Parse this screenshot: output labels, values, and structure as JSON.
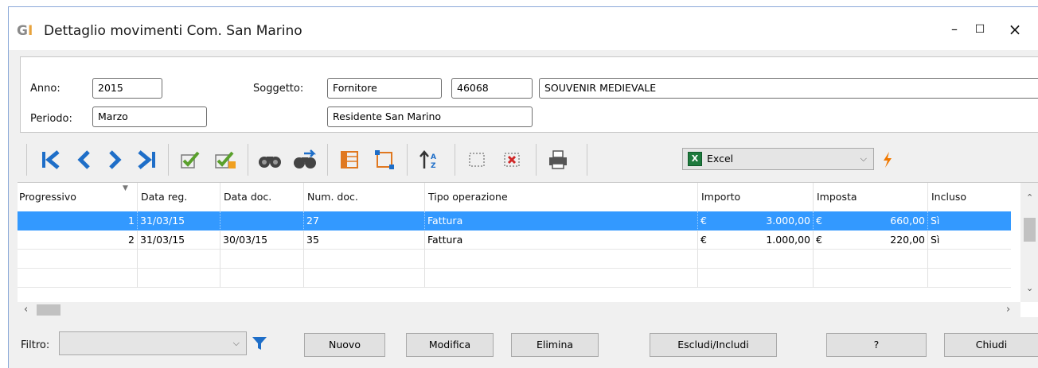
{
  "window": {
    "logo_g": "G",
    "logo_i": "I",
    "title": "Dettaglio movimenti Com. San Marino",
    "minimize": "–",
    "maximize": "☐",
    "close": "×"
  },
  "header": {
    "anno_label": "Anno:",
    "anno_value": "2015",
    "periodo_label": "Periodo:",
    "periodo_value": "Marzo",
    "soggetto_label": "Soggetto:",
    "soggetto_tipo": "Fornitore",
    "soggetto_codice": "46068",
    "soggetto_nome": "SOUVENIR MEDIEVALE",
    "residenza": "Residente San Marino"
  },
  "toolbar": {
    "export_selected": "Excel",
    "icons": [
      "first-icon",
      "prev-icon",
      "next-icon",
      "last-icon",
      "check-icon",
      "check-edit-icon",
      "binoculars-icon",
      "binoculars-next-icon",
      "columns-icon",
      "layout-icon",
      "sort-az-icon",
      "select-area-icon",
      "deselect-area-icon",
      "printer-icon",
      "excel-icon",
      "lightning-icon"
    ]
  },
  "grid": {
    "columns": [
      "Progressivo",
      "Data reg.",
      "Data doc.",
      "Num. doc.",
      "Tipo operazione",
      "Importo",
      "Imposta",
      "Incluso"
    ],
    "rows": [
      {
        "progressivo": "1",
        "data_reg": "31/03/15",
        "data_doc": "",
        "num_doc": "27",
        "tipo": "Fattura",
        "importo_cur": "€",
        "importo": "3.000,00",
        "imposta_cur": "€",
        "imposta": "660,00",
        "incluso": "Sì"
      },
      {
        "progressivo": "2",
        "data_reg": "31/03/15",
        "data_doc": "30/03/15",
        "num_doc": "35",
        "tipo": "Fattura",
        "importo_cur": "€",
        "importo": "1.000,00",
        "imposta_cur": "€",
        "imposta": "220,00",
        "incluso": "Sì"
      }
    ]
  },
  "footer": {
    "filtro_label": "Filtro:",
    "filtro_value": "",
    "buttons": {
      "nuovo": "Nuovo",
      "modifica": "Modifica",
      "elimina": "Elimina",
      "escludi": "Escludi/Includi",
      "help": "?",
      "chiudi": "Chiudi"
    }
  },
  "colors": {
    "selection": "#3399ff",
    "nav_blue": "#1e6ec8",
    "check_green": "#5aa02c",
    "excel_green": "#1e7a3d",
    "lightning": "#f07800"
  }
}
